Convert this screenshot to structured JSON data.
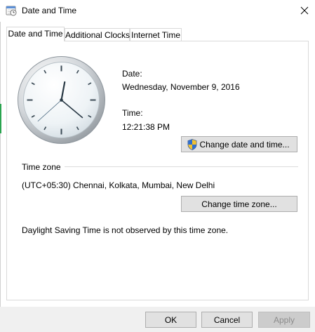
{
  "window": {
    "title": "Date and Time",
    "close_icon": "close-icon"
  },
  "tabs": [
    {
      "label": "Date and Time",
      "active": true
    },
    {
      "label": "Additional Clocks",
      "active": false
    },
    {
      "label": "Internet Time",
      "active": false
    }
  ],
  "clock": {
    "time": "12:21:38"
  },
  "date": {
    "label": "Date:",
    "value": "Wednesday, November 9, 2016"
  },
  "time": {
    "label": "Time:",
    "value": "12:21:38 PM"
  },
  "change_datetime_button": {
    "label": "Change date and time...",
    "icon": "uac-shield-icon"
  },
  "timezone": {
    "group_label": "Time zone",
    "value": "(UTC+05:30) Chennai, Kolkata, Mumbai, New Delhi",
    "change_button": "Change time zone...",
    "dst_note": "Daylight Saving Time is not observed by this time zone."
  },
  "footer": {
    "ok": "OK",
    "cancel": "Cancel",
    "apply": "Apply",
    "apply_enabled": false
  }
}
